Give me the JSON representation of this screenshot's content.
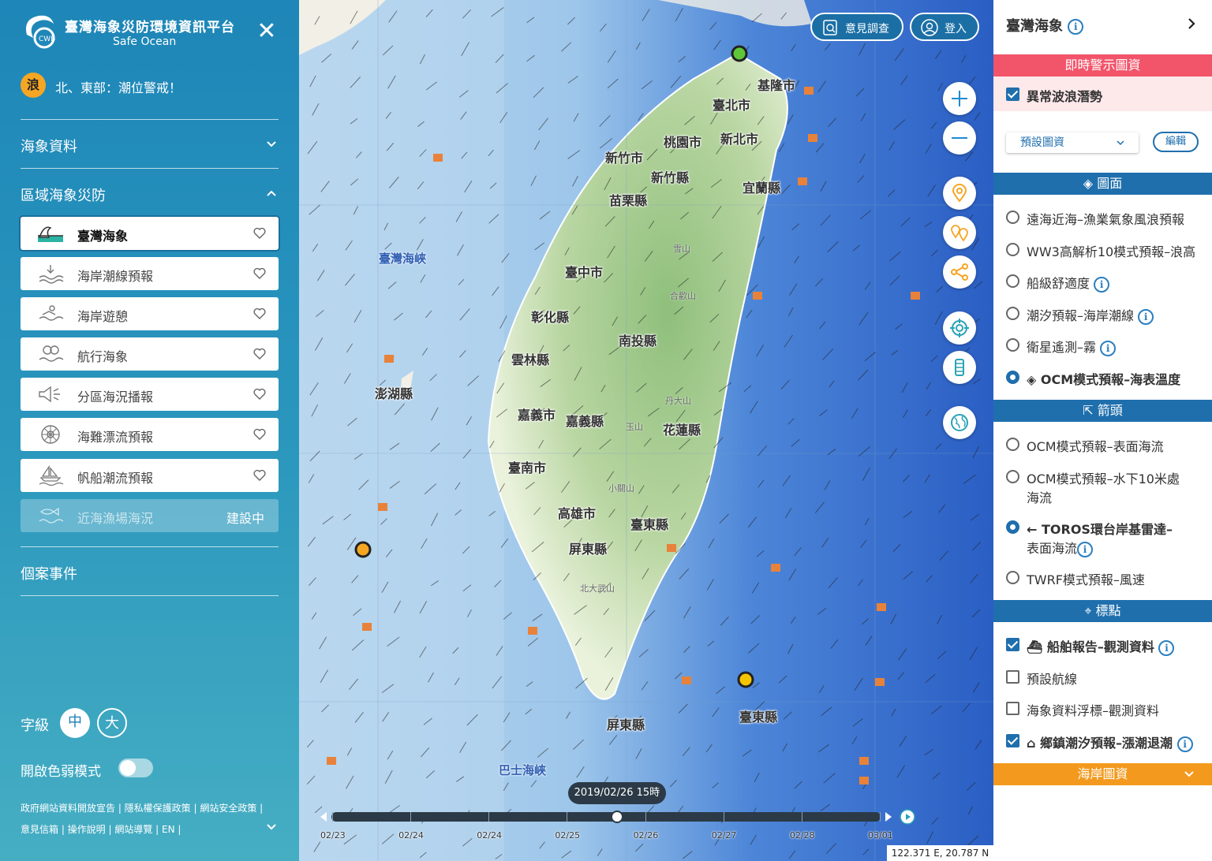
{
  "left_panel": {
    "brand_title": "臺灣海象災防環境資訊平台",
    "brand_subtitle": "Safe Ocean",
    "alert": {
      "badge": "浪",
      "text": "北、東部：潮位警戒！"
    },
    "sections": {
      "ocean_data": "海象資料",
      "regional_disaster": "區域海象災防",
      "cases": "個案事件"
    },
    "menu_items": [
      {
        "label": "臺灣海象",
        "icon": "wave-icon",
        "active": true
      },
      {
        "label": "海岸潮線預報",
        "icon": "coast-tide-icon"
      },
      {
        "label": "海岸遊憩",
        "icon": "swimmer-icon"
      },
      {
        "label": "航行海象",
        "icon": "navigation-icon"
      },
      {
        "label": "分區海況播報",
        "icon": "speaker-icon"
      },
      {
        "label": "海難漂流預報",
        "icon": "ship-wheel-icon"
      },
      {
        "label": "帆船潮流預報",
        "icon": "sailboat-icon"
      },
      {
        "label": "近海漁場海況",
        "icon": "fishery-icon",
        "disabled": true,
        "tag": "建設中"
      }
    ],
    "font_size": {
      "label": "字級",
      "options": [
        "中",
        "大"
      ],
      "selected": "中"
    },
    "color_blind": {
      "label": "開啟色弱模式",
      "enabled": false
    },
    "links_line1": "政府網站資料開放宣告 | 隱私權保護政策 | 網站安全政策 |",
    "links_line2": "意見信箱 | 操作說明 | 網站導覽 | EN |"
  },
  "map": {
    "buttons": {
      "survey": "意見調查",
      "login": "登入"
    },
    "cities": [
      "基隆市",
      "臺北市",
      "桃園市",
      "新北市",
      "新竹市",
      "新竹縣",
      "宜蘭縣",
      "苗栗縣",
      "臺中市",
      "彰化縣",
      "南投縣",
      "雲林縣",
      "澎湖縣",
      "嘉義市",
      "嘉義縣",
      "花蓮縣",
      "臺南市",
      "高雄市",
      "臺東縣",
      "屏東縣",
      "屏東縣",
      "臺東縣"
    ],
    "mountains": [
      "雪山",
      "合歡山",
      "丹大山",
      "玉山",
      "小關山",
      "北大武山"
    ],
    "seas": [
      "臺灣海峽",
      "巴士海峽"
    ],
    "timeline": {
      "current": "2019/02/26 15時",
      "current_fraction": 0.52,
      "dates": [
        "02/23",
        "02/24",
        "02/24",
        "02/25",
        "02/26",
        "02/27",
        "02/28",
        "03/01"
      ]
    },
    "coordinates": "122.371 E, 20.787 N"
  },
  "right_panel": {
    "title": "臺灣海象",
    "alert_bar": "即時警示圖資",
    "alert_layer": {
      "label": "異常波浪潛勢",
      "checked": true
    },
    "preset": "預設圖資",
    "edit": "編輯",
    "surface_bar": "圖面",
    "surface_layers": [
      {
        "label": "遠海近海–漁業氣象風浪預報",
        "selected": false
      },
      {
        "label": "WW3高解析10模式預報–浪高",
        "selected": false
      },
      {
        "label": "船級舒適度",
        "selected": false,
        "info": true
      },
      {
        "label": "潮汐預報–海岸潮線",
        "selected": false,
        "info": true
      },
      {
        "label": "衛星遙測–霧",
        "selected": false,
        "info": true
      },
      {
        "label": "OCM模式預報–海表溫度",
        "selected": true
      }
    ],
    "arrow_bar": "箭頭",
    "arrow_layers": [
      {
        "label": "OCM模式預報–表面海流",
        "selected": false
      },
      {
        "label": "OCM模式預報–水下10米處",
        "label2": "海流",
        "selected": false
      },
      {
        "label": "TOROS環台岸基雷達–",
        "label2": "表面海流",
        "selected": true,
        "info": true
      },
      {
        "label": "TWRF模式預報–風速",
        "selected": false
      }
    ],
    "marker_bar": "標點",
    "marker_layers": [
      {
        "label": "船舶報告–觀測資料",
        "checked": true,
        "info": true
      },
      {
        "label": "預設航線",
        "checked": false
      },
      {
        "label": "海象資料浮標–觀測資料",
        "checked": false
      },
      {
        "label": "鄉鎮潮汐預報–漲潮退潮",
        "checked": true,
        "info": true
      }
    ],
    "coast_bar": "海岸圖資",
    "colors": {
      "blue_bar": "#1f6fad",
      "alert_bar": "#f2546a",
      "coast_bar": "#f39a1e"
    }
  }
}
